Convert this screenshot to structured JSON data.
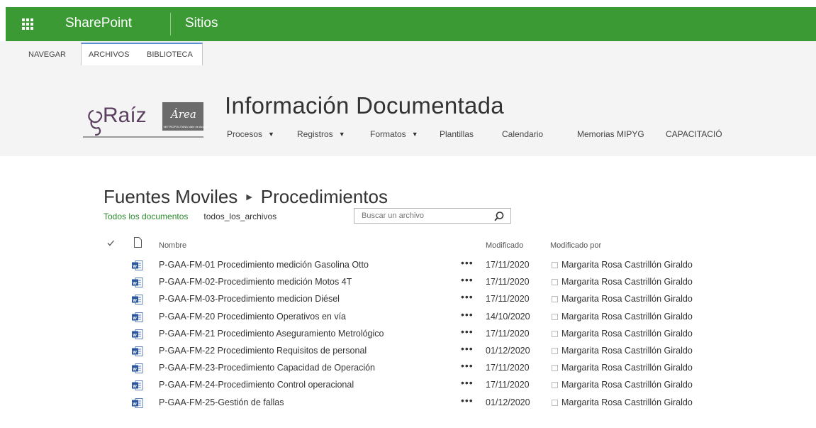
{
  "suite_bar": {
    "app_name": "SharePoint",
    "section": "Sitios",
    "color": "#3b9a34"
  },
  "ribbon_tabs": [
    {
      "label": "NAVEGAR",
      "selected": false
    },
    {
      "label": "ARCHIVOS",
      "selected": true
    },
    {
      "label": "BIBLIOTECA",
      "selected": false
    }
  ],
  "site": {
    "logo_text": "Raíz",
    "logo_brand": "Área",
    "logo_subtitle": "METROPOLITANA Valle de Aburrá",
    "title": "Información Documentada",
    "nav": [
      {
        "label": "Procesos",
        "has_dropdown": true
      },
      {
        "label": "Registros",
        "has_dropdown": true
      },
      {
        "label": "Formatos",
        "has_dropdown": true
      },
      {
        "label": "Plantillas",
        "has_dropdown": false
      },
      {
        "label": "Calendario",
        "has_dropdown": false
      },
      {
        "label": "Memorias MIPYG",
        "has_dropdown": false
      },
      {
        "label": "CAPACITACIÓ",
        "has_dropdown": false
      }
    ]
  },
  "breadcrumb": {
    "parent": "Fuentes Moviles",
    "current": "Procedimientos"
  },
  "views": {
    "all_documents": "Todos los documentos",
    "all_files": "todos_los_archivos",
    "search_placeholder": "Buscar un archivo"
  },
  "columns": {
    "name": "Nombre",
    "modified": "Modificado",
    "modified_by": "Modificado por"
  },
  "documents": [
    {
      "name": "P-GAA-FM-01 Procedimiento medición Gasolina Otto",
      "modified": "17/11/2020",
      "modified_by": "Margarita Rosa Castrillón Giraldo"
    },
    {
      "name": "P-GAA-FM-02-Procedimiento medición Motos 4T",
      "modified": "17/11/2020",
      "modified_by": "Margarita Rosa Castrillón Giraldo"
    },
    {
      "name": "P-GAA-FM-03-Procedimiento medicion Diésel",
      "modified": "17/11/2020",
      "modified_by": "Margarita Rosa Castrillón Giraldo"
    },
    {
      "name": "P-GAA-FM-20 Procedimiento Operativos en vía",
      "modified": "14/10/2020",
      "modified_by": "Margarita Rosa Castrillón Giraldo"
    },
    {
      "name": "P-GAA-FM-21 Procedimiento Aseguramiento Metrológico",
      "modified": "17/11/2020",
      "modified_by": "Margarita Rosa Castrillón Giraldo"
    },
    {
      "name": "P-GAA-FM-22 Procedimiento Requisitos de personal",
      "modified": "01/12/2020",
      "modified_by": "Margarita Rosa Castrillón Giraldo"
    },
    {
      "name": "P-GAA-FM-23-Procedimiento Capacidad de Operación",
      "modified": "17/11/2020",
      "modified_by": "Margarita Rosa Castrillón Giraldo"
    },
    {
      "name": "P-GAA-FM-24-Procedimiento Control operacional",
      "modified": "17/11/2020",
      "modified_by": "Margarita Rosa Castrillón Giraldo"
    },
    {
      "name": "P-GAA-FM-25-Gestión de fallas",
      "modified": "01/12/2020",
      "modified_by": "Margarita Rosa Castrillón Giraldo"
    }
  ],
  "more_actions_glyph": "•••",
  "icons": {
    "waffle": "app-launcher-icon",
    "check": "select-all-check-icon",
    "file": "file-type-header-icon",
    "word": "word-document-icon",
    "search": "search-icon",
    "presence": "presence-icon"
  }
}
